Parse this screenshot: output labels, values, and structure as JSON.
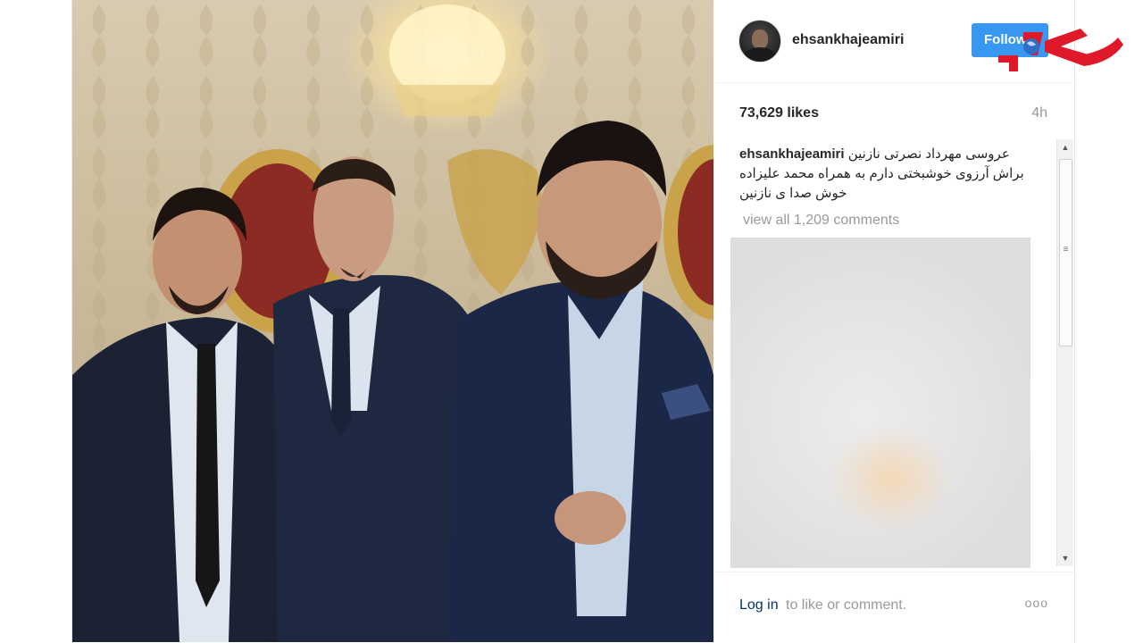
{
  "post": {
    "username": "ehsankhajeamiri",
    "follow_label": "Follow",
    "likes": "73,629 likes",
    "time": "4h",
    "caption": {
      "user": "ehsankhajeamiri",
      "text": "عروسی مهرداد نصرتی نازنین براش آرزوی خوشبختی دارم به همراه محمد علیزاده خوش صدا ی نازنین"
    },
    "view_all": "view all 1,209 comments",
    "footer": {
      "login": "Log in",
      "rest": "to like or comment.",
      "more": "ooo"
    }
  },
  "icons": {
    "avatar": "profile-avatar",
    "logo": "rokna-logo",
    "more": "more-options-icon",
    "scroll_up": "scroll-up-arrow",
    "scroll_down": "scroll-down-arrow"
  },
  "colors": {
    "follow": "#3897f0",
    "logo_red": "#e0192a",
    "link": "#003569",
    "muted": "#999999"
  }
}
